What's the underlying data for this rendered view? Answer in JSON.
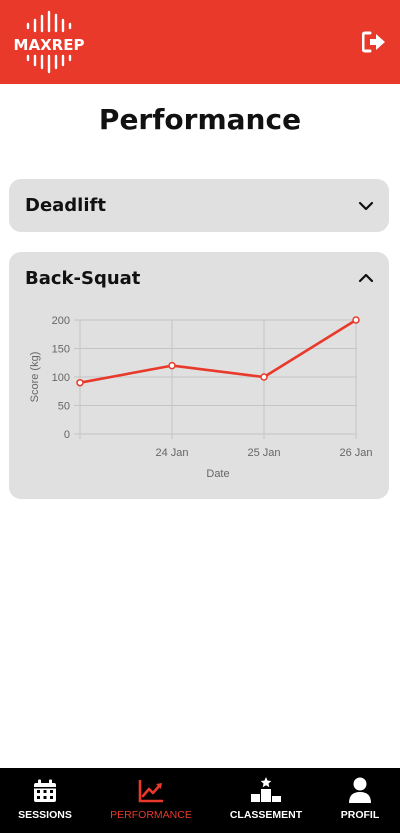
{
  "header": {
    "logo_text": "MAXREP",
    "brand_color": "#e8392a",
    "logout_icon": "logout-icon"
  },
  "page": {
    "title": "Performance"
  },
  "exercises": [
    {
      "name": "Deadlift",
      "expanded": false,
      "toggle_icon": "chevron-down-icon"
    },
    {
      "name": "Back-Squat",
      "expanded": true,
      "toggle_icon": "chevron-up-icon"
    }
  ],
  "chart_data": {
    "type": "line",
    "title": "",
    "xlabel": "Date",
    "ylabel": "Score (kg)",
    "ylim": [
      0,
      200
    ],
    "y_ticks": [
      0,
      50,
      100,
      150,
      200
    ],
    "x_tick_labels": [
      "24 Jan",
      "25 Jan",
      "26 Jan"
    ],
    "grid": true,
    "line_color": "#e8392a",
    "series": [
      {
        "x": [
          "23 Jan",
          "24 Jan",
          "25 Jan",
          "26 Jan"
        ],
        "values": [
          90,
          120,
          100,
          200
        ]
      }
    ]
  },
  "tabbar": {
    "active_color": "#e8392a",
    "tabs": [
      {
        "label": "SESSIONS",
        "icon": "calendar-icon",
        "active": false
      },
      {
        "label": "PERFORMANCE",
        "icon": "chart-line-icon",
        "active": true
      },
      {
        "label": "CLASSEMENT",
        "icon": "podium-icon",
        "active": false
      },
      {
        "label": "PROFIL",
        "icon": "user-icon",
        "active": false
      }
    ]
  }
}
